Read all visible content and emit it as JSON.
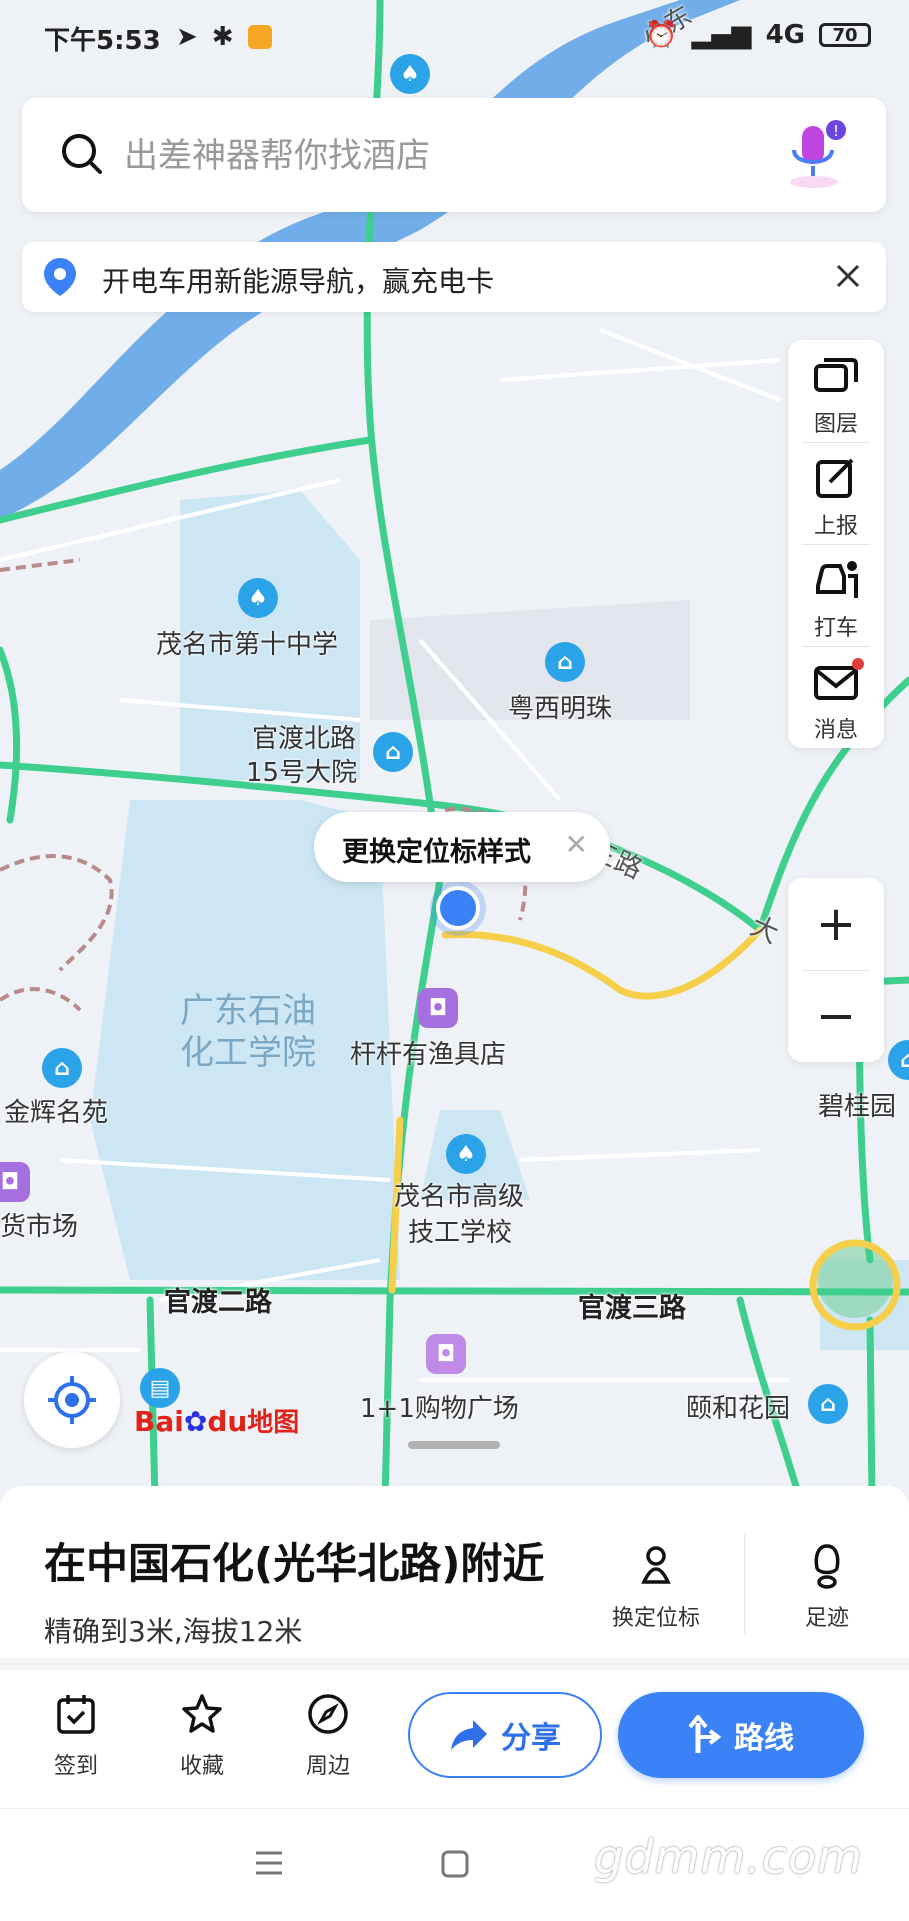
{
  "status_bar": {
    "time": "下午5:53",
    "network": "4G",
    "battery": "70"
  },
  "search": {
    "placeholder": "出差神器帮你找酒店"
  },
  "banner": {
    "text": "开电车用新能源导航，赢充电卡"
  },
  "map_tools": [
    {
      "label": "图层",
      "icon": "layers-icon"
    },
    {
      "label": "上报",
      "icon": "report-icon"
    },
    {
      "label": "打车",
      "icon": "taxi-icon"
    },
    {
      "label": "消息",
      "icon": "message-icon"
    }
  ],
  "zoom": {
    "in": "+",
    "out": "−"
  },
  "tooltip": {
    "text": "更换定位标样式"
  },
  "map_labels": {
    "school10": "茂名市第十中学",
    "yuexi": "粤西明珠",
    "guandu15_1": "官渡北路",
    "guandu15_2": "15号大院",
    "university_1": "广东石油",
    "university_2": "化工学院",
    "fishing": "杆杆有渔具店",
    "jinhui": "金辉名苑",
    "market": "货市场",
    "technical_1": "茂名市高级",
    "technical_2": "技工学校",
    "biguiyuan": "碧桂园",
    "road_guandu2": "官渡二路",
    "road_guandu3": "官渡三路",
    "road_top": "小东",
    "road_da": "大",
    "road_san": "三路",
    "mall": "1+1购物广场",
    "yihe": "颐和花园"
  },
  "logo": {
    "text_b": "Bai",
    "text_du": "du",
    "text_map": "地图"
  },
  "location": {
    "title": "在中国石化(光华北路)附近",
    "subtitle": "精确到3米,海拔12米"
  },
  "sheet_actions": [
    {
      "label": "换定位标",
      "icon": "location-marker-icon"
    },
    {
      "label": "足迹",
      "icon": "footprint-icon"
    }
  ],
  "bottom_actions": [
    {
      "label": "签到",
      "icon": "checkin-icon"
    },
    {
      "label": "收藏",
      "icon": "star-icon"
    },
    {
      "label": "周边",
      "icon": "compass-icon"
    }
  ],
  "buttons": {
    "share": "分享",
    "route": "路线"
  },
  "watermark": "gdmm.com",
  "colors": {
    "accent": "#3b82f6",
    "road_green": "#3ecf8e",
    "road_yellow": "#f6cf4a",
    "water": "#5aa2e6"
  }
}
